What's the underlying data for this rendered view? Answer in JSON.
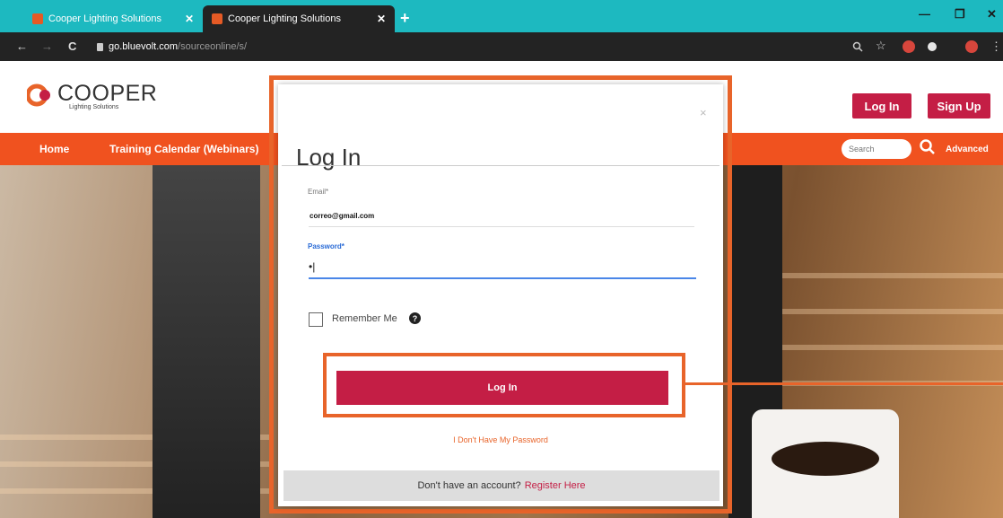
{
  "browser": {
    "tabs": [
      {
        "title": "Cooper Lighting Solutions"
      },
      {
        "title": "Cooper Lighting Solutions"
      }
    ],
    "new_tab": "+",
    "url_host": "go.bluevolt.com",
    "url_path": "/sourceonline/s/"
  },
  "site": {
    "logo": {
      "name": "COOPER",
      "tagline": "Lighting Solutions"
    },
    "header_buttons": {
      "login": "Log In",
      "signup": "Sign Up"
    },
    "nav": {
      "home": "Home",
      "training": "Training Calendar (Webinars)",
      "search_placeholder": "Search",
      "advanced": "Advanced"
    }
  },
  "modal": {
    "title": "Log In",
    "close": "×",
    "email_label": "Email*",
    "email_value": "correo@gmail.com",
    "password_label": "Password*",
    "password_value": "•|",
    "remember_label": "Remember Me",
    "help": "?",
    "login_button": "Log In",
    "forgot_link": "I Don't Have My Password",
    "register_prompt": "Don't have an account?",
    "register_link": "Register Here"
  },
  "colors": {
    "brand_red": "#c41e45",
    "nav_orange": "#f0521f",
    "highlight": "#e8642a",
    "tab_teal": "#1db9c0"
  }
}
